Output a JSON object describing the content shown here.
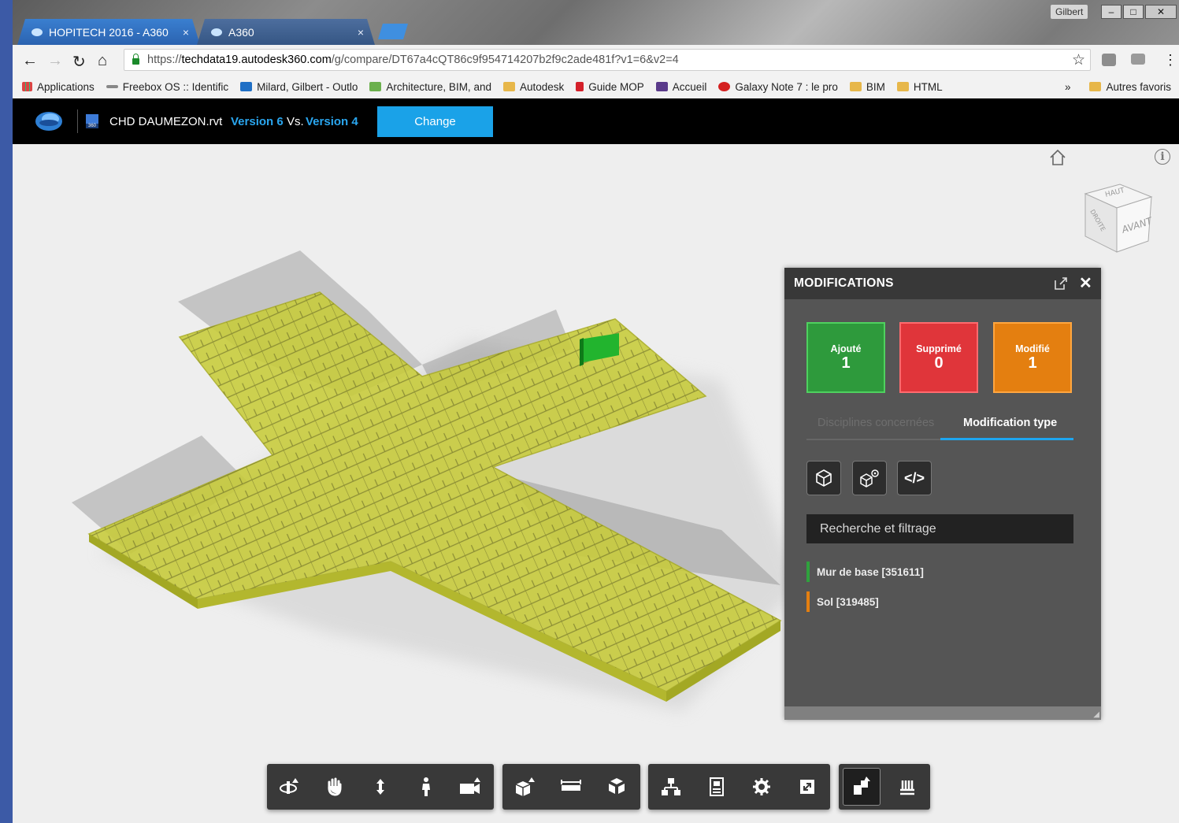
{
  "browser": {
    "tabs": [
      {
        "title": "HOPITECH 2016 - A360",
        "close": "×"
      },
      {
        "title": "A360",
        "close": "×"
      }
    ],
    "user": "Gilbert",
    "window_controls": {
      "minimize": "–",
      "maximize": "□",
      "close": "✕"
    },
    "url": {
      "scheme": "https://",
      "host": "techdata19.autodesk360.com",
      "path": "/g/compare/DT67a4cQT86c9f954714207b2f9c2ade481f?v1=6&v2=4"
    },
    "bookmarks": [
      {
        "label": "Applications",
        "icon": "apps-grid-icon"
      },
      {
        "label": "Freebox OS :: Identific",
        "icon": "freebox-icon"
      },
      {
        "label": "Milard, Gilbert - Outlo",
        "icon": "outlook-icon"
      },
      {
        "label": "Architecture, BIM, and",
        "icon": "site-icon"
      },
      {
        "label": "Autodesk",
        "icon": "folder-icon"
      },
      {
        "label": "Guide MOP",
        "icon": "site-icon"
      },
      {
        "label": "Accueil",
        "icon": "site-icon"
      },
      {
        "label": "Galaxy Note 7 : le pro",
        "icon": "site-icon"
      },
      {
        "label": "BIM",
        "icon": "folder-icon"
      },
      {
        "label": "HTML",
        "icon": "folder-icon"
      }
    ],
    "bookmarks_overflow": "»",
    "other_bookmarks": "Autres favoris"
  },
  "app": {
    "file_name": "CHD DAUMEZON.rvt",
    "version_a": "Version 6",
    "vs": "Vs.",
    "version_b": "Version 4",
    "change_button": "Change"
  },
  "viewcube": {
    "top": "HAUT",
    "front": "AVANT",
    "side": "DROITE"
  },
  "panel": {
    "title": "MODIFICATIONS",
    "stats": {
      "added": {
        "label": "Ajouté",
        "value": "1",
        "color": "#2e9a3c"
      },
      "removed": {
        "label": "Supprimé",
        "value": "0",
        "color": "#e0353a"
      },
      "modified": {
        "label": "Modifié",
        "value": "1",
        "color": "#e47f10"
      }
    },
    "tabs": [
      "Disciplines concernées",
      "Modification type"
    ],
    "active_tab": "Modification type",
    "search_placeholder": "Recherche et filtrage",
    "items": [
      {
        "label": "Mur de base [351611]",
        "status": "added",
        "color": "#2fa23d"
      },
      {
        "label": "Sol [319485]",
        "status": "modified",
        "color": "#e47f10"
      }
    ]
  },
  "toolbar": {
    "groups": [
      [
        "orbit-icon",
        "pan-icon",
        "zoom-icon",
        "first-person-icon",
        "camera-icon"
      ],
      [
        "section-box-icon",
        "measure-icon",
        "explode-icon"
      ],
      [
        "model-browser-icon",
        "properties-icon",
        "settings-icon",
        "fullscreen-icon"
      ],
      [
        "compare-icon",
        "levels-icon"
      ]
    ]
  },
  "colors": {
    "accent": "#1aa2e8",
    "model": "#c8cc3a",
    "added": "#2fa23d"
  }
}
